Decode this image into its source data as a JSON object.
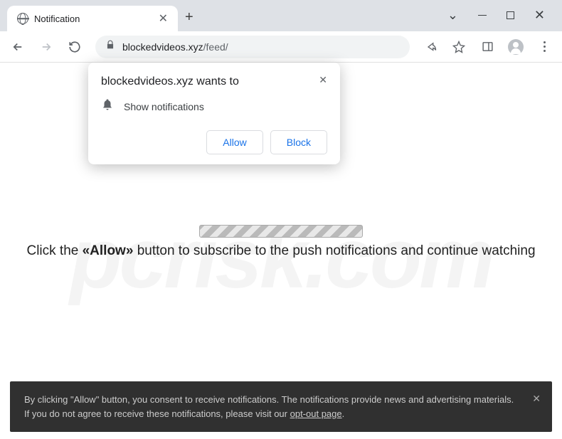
{
  "window": {
    "tab_title": "Notification"
  },
  "toolbar": {
    "url_host": "blockedvideos.xyz",
    "url_path": "/feed/"
  },
  "permission_prompt": {
    "title": "blockedvideos.xyz wants to",
    "line": "Show notifications",
    "allow": "Allow",
    "block": "Block"
  },
  "page": {
    "instruction_pre": "Click the ",
    "instruction_allow": "«Allow»",
    "instruction_post": " button to subscribe to the push notifications and continue watching",
    "watermark": "pcrisk.com"
  },
  "banner": {
    "text_1": "By clicking \"Allow\" button, you consent to receive notifications. The notifications provide news and advertising materials. If you do not agree to receive these notifications, please visit our ",
    "link": "opt-out page",
    "text_2": "."
  }
}
